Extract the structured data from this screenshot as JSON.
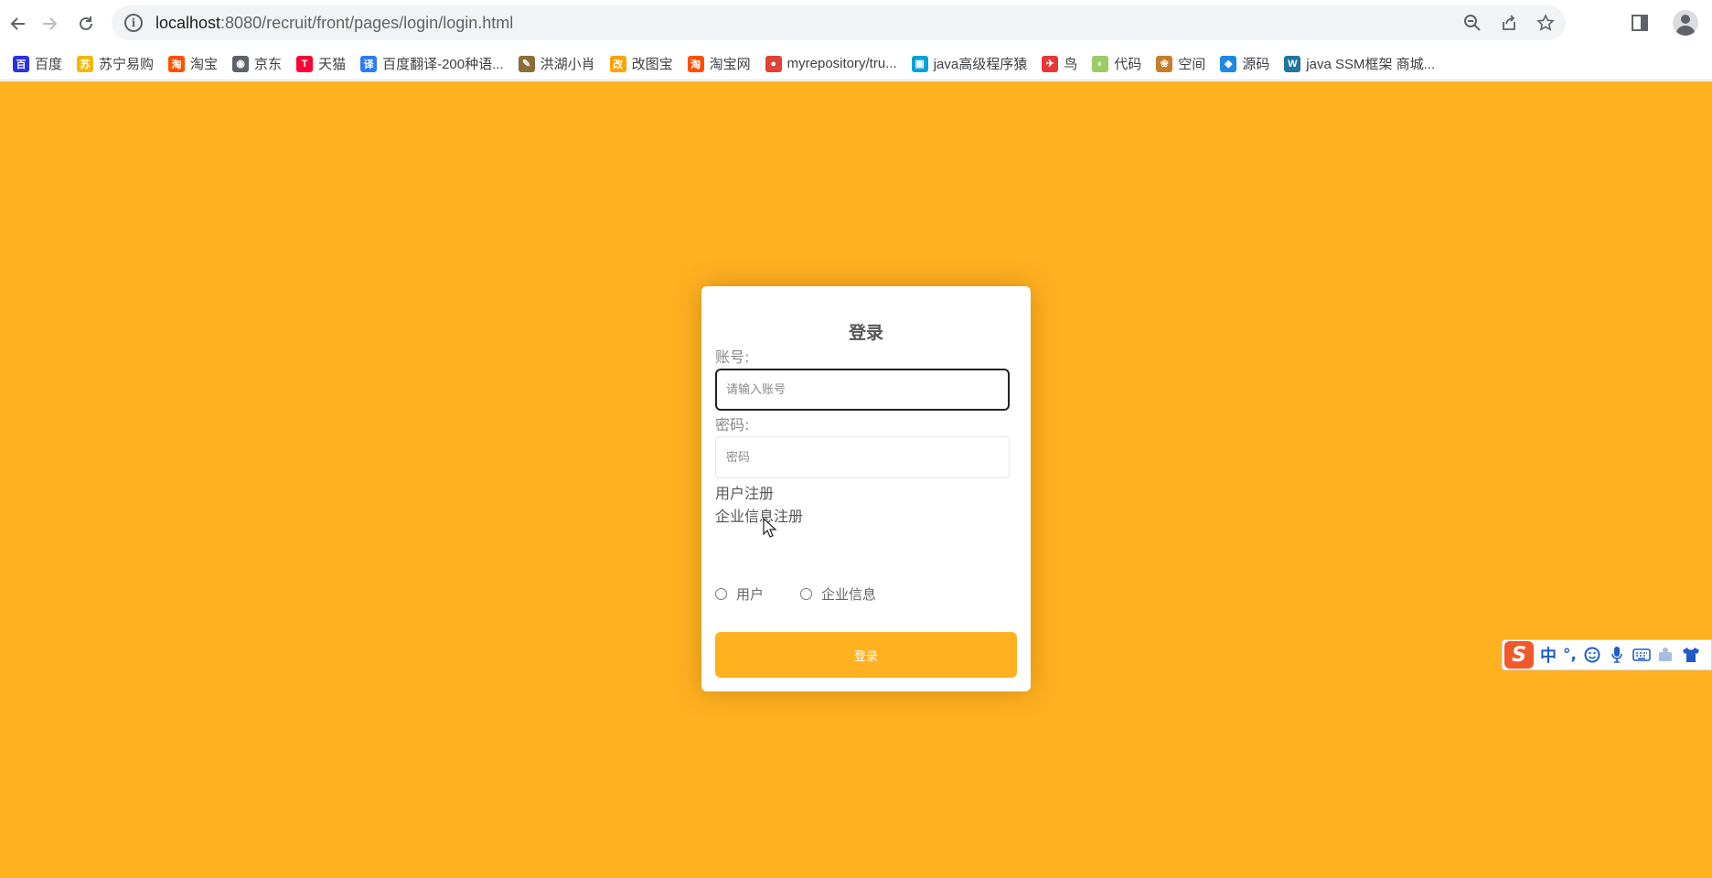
{
  "browser": {
    "url_host": "localhost",
    "url_path": ":8080/recruit/front/pages/login/login.html",
    "bookmarks": [
      {
        "label": "百度",
        "icon": "baidu-icon",
        "color": "#2932e1",
        "glyph": "百"
      },
      {
        "label": "苏宁易购",
        "icon": "suning-icon",
        "color": "#f5b700",
        "glyph": "苏"
      },
      {
        "label": "淘宝",
        "icon": "taobao-icon",
        "color": "#ff5000",
        "glyph": "淘"
      },
      {
        "label": "京东",
        "icon": "globe-icon",
        "color": "#5f6368",
        "glyph": "◉"
      },
      {
        "label": "天猫",
        "icon": "tmall-icon",
        "color": "#ff0036",
        "glyph": "T"
      },
      {
        "label": "百度翻译-200种语...",
        "icon": "baidu-translate-icon",
        "color": "#2f7bf6",
        "glyph": "译"
      },
      {
        "label": "洪湖小肖",
        "icon": "bird-icon",
        "color": "#8a6d3b",
        "glyph": "✎"
      },
      {
        "label": "改图宝",
        "icon": "gaitubao-icon",
        "color": "#ffa200",
        "glyph": "改"
      },
      {
        "label": "淘宝网",
        "icon": "taobao-net-icon",
        "color": "#ff5000",
        "glyph": "淘"
      },
      {
        "label": "myrepository/tru...",
        "icon": "chrome-icon",
        "color": "#db4437",
        "glyph": "●"
      },
      {
        "label": "java高级程序猿",
        "icon": "bilibili-icon",
        "color": "#00a1d6",
        "glyph": "▣"
      },
      {
        "label": "鸟",
        "icon": "bird-red-icon",
        "color": "#e53935",
        "glyph": "✈"
      },
      {
        "label": "代码",
        "icon": "code-icon",
        "color": "#9ccc65",
        "glyph": "◐"
      },
      {
        "label": "空间",
        "icon": "space-icon",
        "color": "#c77c2a",
        "glyph": "❀"
      },
      {
        "label": "源码",
        "icon": "source-icon",
        "color": "#1e88e5",
        "glyph": "◆"
      },
      {
        "label": "java SSM框架 商城...",
        "icon": "wordpress-icon",
        "color": "#21759b",
        "glyph": "W"
      }
    ]
  },
  "login": {
    "title": "登录",
    "account_label": "账号:",
    "account_placeholder": "请输入账号",
    "password_label": "密码:",
    "password_placeholder": "密码",
    "register_user": "用户注册",
    "register_company": "企业信息注册",
    "role_user": "用户",
    "role_company": "企业信息",
    "submit": "登录"
  },
  "ime": {
    "logo": "S",
    "mode": "中",
    "punct": "°,"
  },
  "colors": {
    "page_bg": "#ffb120",
    "button_bg": "#ffb120"
  }
}
